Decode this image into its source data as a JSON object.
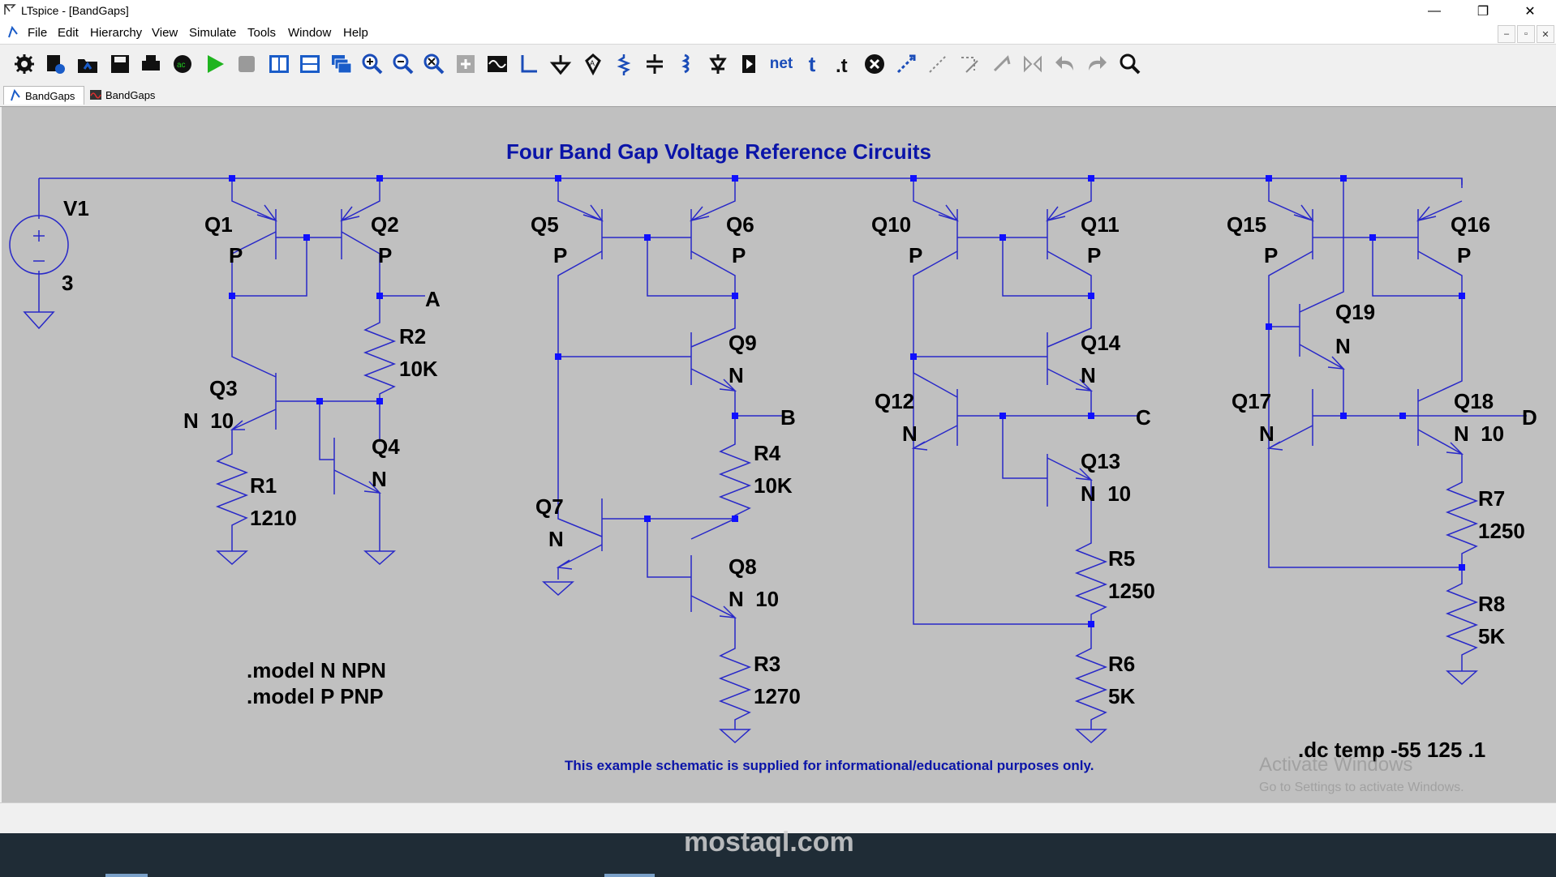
{
  "window": {
    "title": "LTspice - [BandGaps]",
    "minimize": "—",
    "restore": "❐",
    "close": "✕"
  },
  "menu": {
    "items": [
      "File",
      "Edit",
      "Hierarchy",
      "View",
      "Simulate",
      "Tools",
      "Window",
      "Help"
    ]
  },
  "mdi": {
    "minimize": "–",
    "restore": "▫",
    "close": "✕"
  },
  "toolbar": {
    "icons": [
      "gear-icon",
      "new-schematic-icon",
      "open-icon",
      "save-icon",
      "print-icon",
      "control-panel-icon",
      "run-icon",
      "halt-icon",
      "tile-vertical-icon",
      "tile-horizontal-icon",
      "cascade-icon",
      "zoom-in-icon",
      "zoom-out-icon",
      "zoom-fit-icon",
      "autorange-icon",
      "waveform-icon",
      "wire-icon",
      "ground-icon",
      "label-net-icon",
      "resistor-icon",
      "capacitor-icon",
      "inductor-icon",
      "diode-icon",
      "component-icon",
      "netlist-icon",
      "text-icon",
      "spice-directive-icon",
      "delete-icon",
      "duplicate-icon",
      "move-icon",
      "drag-icon",
      "rotate-icon",
      "mirror-icon",
      "undo-icon",
      "redo-icon",
      "find-icon"
    ],
    "net_label": "net",
    "text_label": "t"
  },
  "tabs": [
    {
      "label": "BandGaps",
      "icon": "schematic-icon",
      "active": true
    },
    {
      "label": "BandGaps",
      "icon": "waveform-icon",
      "active": false
    }
  ],
  "schematic": {
    "title": "Four Band Gap Voltage Reference Circuits",
    "footer_note": "This example schematic is supplied for informational/educational purposes only.",
    "directives": [
      ".model N NPN",
      ".model P PNP",
      ".dc temp -55 125 .1"
    ],
    "source": {
      "name": "V1",
      "value": "3"
    },
    "components": [
      {
        "name": "Q1",
        "value": "P"
      },
      {
        "name": "Q2",
        "value": "P"
      },
      {
        "name": "Q3",
        "value": "N  10"
      },
      {
        "name": "Q4",
        "value": "N"
      },
      {
        "name": "R1",
        "value": "1210"
      },
      {
        "name": "R2",
        "value": "10K"
      },
      {
        "name": "Q5",
        "value": "P"
      },
      {
        "name": "Q6",
        "value": "P"
      },
      {
        "name": "Q7",
        "value": "N"
      },
      {
        "name": "Q8",
        "value": "N  10"
      },
      {
        "name": "Q9",
        "value": "N"
      },
      {
        "name": "R3",
        "value": "1270"
      },
      {
        "name": "R4",
        "value": "10K"
      },
      {
        "name": "Q10",
        "value": "P"
      },
      {
        "name": "Q11",
        "value": "P"
      },
      {
        "name": "Q12",
        "value": "N"
      },
      {
        "name": "Q13",
        "value": "N  10"
      },
      {
        "name": "Q14",
        "value": "N"
      },
      {
        "name": "R5",
        "value": "1250"
      },
      {
        "name": "R6",
        "value": "5K"
      },
      {
        "name": "Q15",
        "value": "P"
      },
      {
        "name": "Q16",
        "value": "P"
      },
      {
        "name": "Q17",
        "value": "N"
      },
      {
        "name": "Q18",
        "value": "N  10"
      },
      {
        "name": "Q19",
        "value": "N"
      },
      {
        "name": "R7",
        "value": "1250"
      },
      {
        "name": "R8",
        "value": "5K"
      }
    ],
    "net_labels": [
      "A",
      "B",
      "C",
      "D"
    ]
  },
  "watermarks": {
    "activate": "Activate Windows",
    "activate_sub": "Go to Settings to activate Windows.",
    "site": "mostaql.com"
  },
  "colors": {
    "canvas": "#c0c0c0",
    "wire": "#2828c8",
    "junction": "#1010ff",
    "title": "#0a14a8",
    "text": "#000000"
  }
}
